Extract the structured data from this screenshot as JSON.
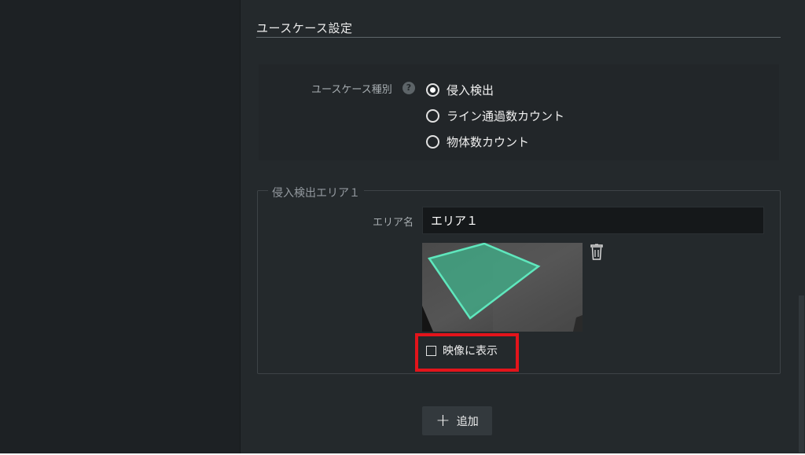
{
  "section": {
    "title": "ユースケース設定"
  },
  "usecase": {
    "label": "ユースケース種別",
    "help_icon": "?",
    "options": [
      {
        "label": "侵入検出",
        "checked": true
      },
      {
        "label": "ライン通過数カウント",
        "checked": false
      },
      {
        "label": "物体数カウント",
        "checked": false
      }
    ]
  },
  "area": {
    "legend": "侵入検出エリア１",
    "name_label": "エリア名",
    "name_value": "エリア１",
    "show_on_video_label": "映像に表示",
    "show_on_video_checked": false
  },
  "actions": {
    "add_label": "追加"
  },
  "colors": {
    "highlight": "#e3141b",
    "polygon_stroke": "#5fe7bd",
    "polygon_fill": "#3fb88f"
  },
  "icons": {
    "help": "help-icon",
    "trash": "trash-icon",
    "add": "plus-icon"
  }
}
